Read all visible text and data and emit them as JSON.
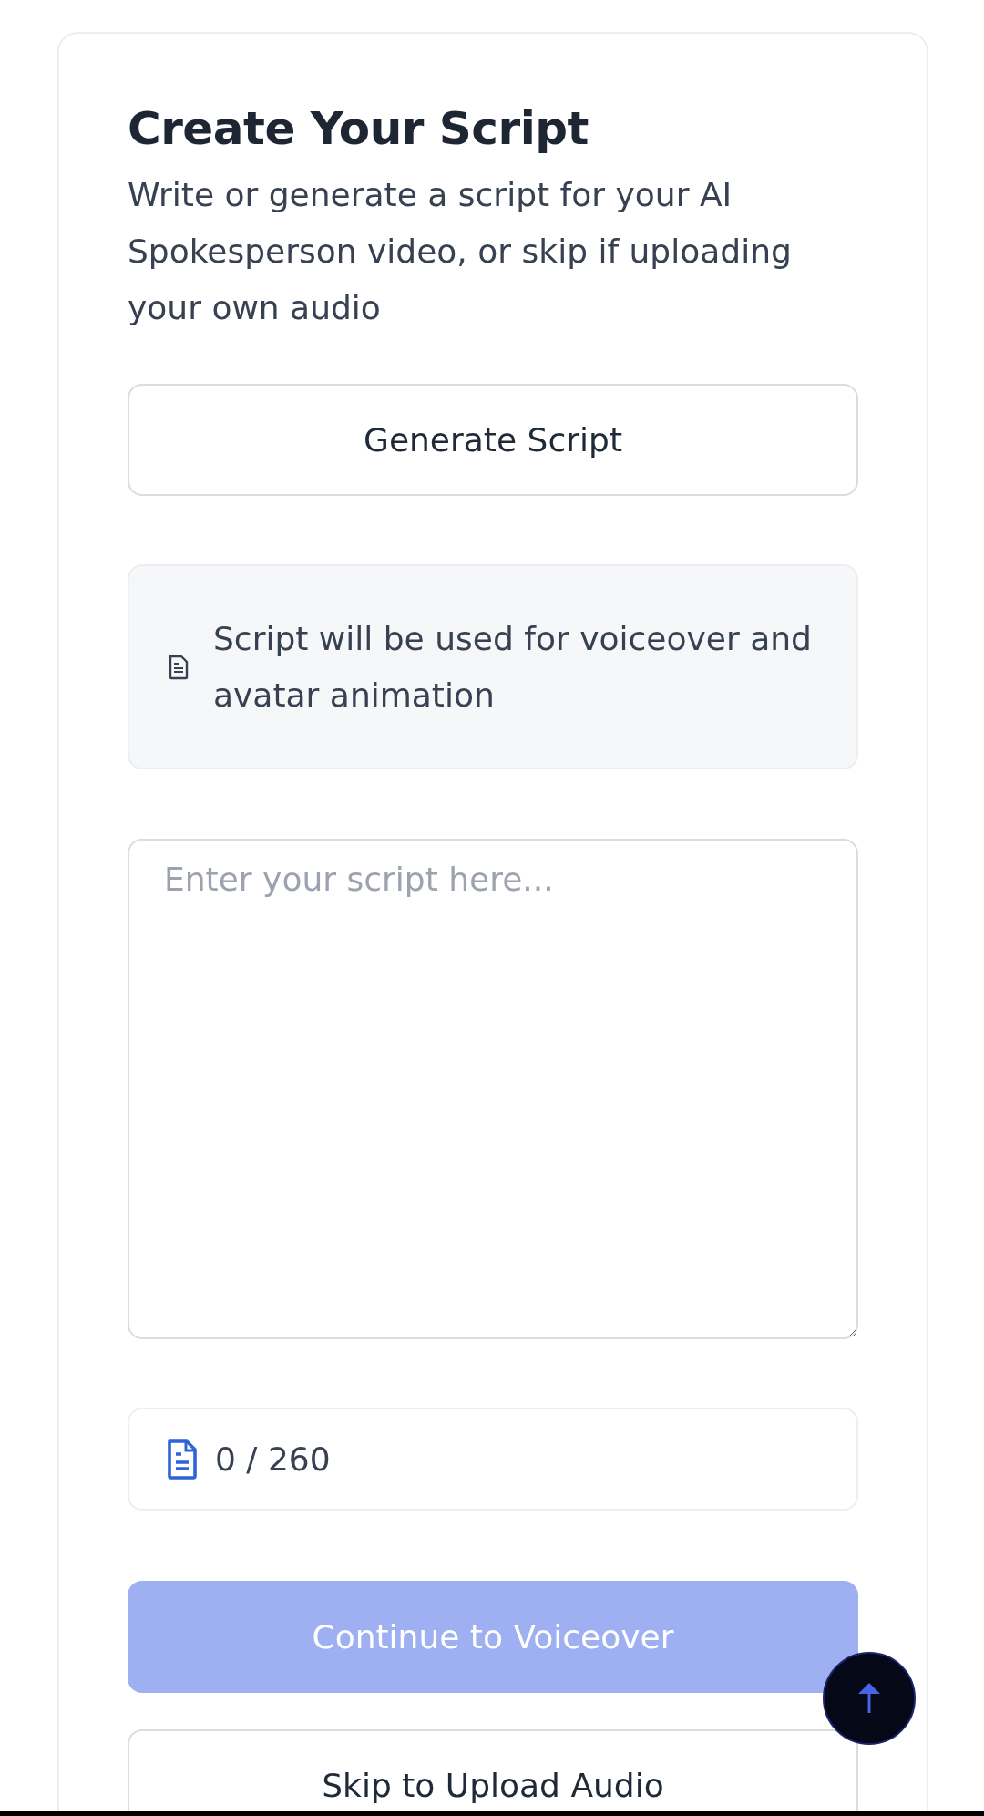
{
  "title": "Create Your Script",
  "subtitle": "Write or generate a script for your AI Spokesperson video, or skip if uploading your own audio",
  "generate_button": {
    "label": "Generate Script"
  },
  "info": {
    "text": "Script will be used for voiceover and avatar animation"
  },
  "script_field": {
    "placeholder": "Enter your script here..."
  },
  "counter": {
    "text": "0 / 260"
  },
  "continue_button": {
    "label": "Continue to Voiceover",
    "disabled": true
  },
  "skip_button": {
    "label": "Skip to Upload Audio"
  }
}
